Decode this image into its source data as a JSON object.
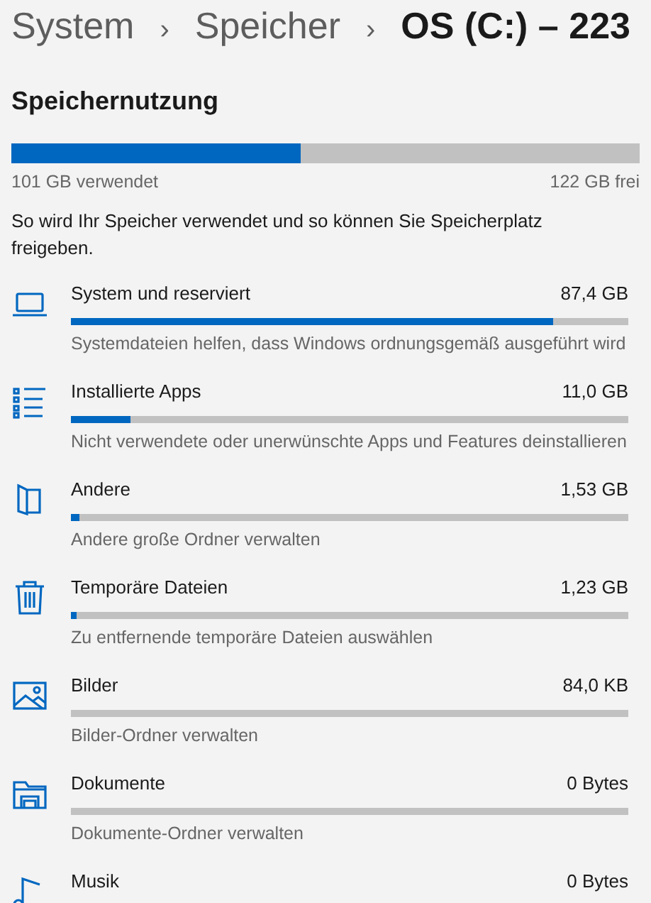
{
  "breadcrumb": [
    "System",
    "Speicher",
    "OS (C:) – 223"
  ],
  "separator": "›",
  "section_title": "Speichernutzung",
  "usage": {
    "level": 0.46,
    "used": "101 GB verwendet",
    "free": "122 GB frei"
  },
  "description": "So wird Ihr Speicher verwendet und so können Sie Speicherplatz freigeben.",
  "categories": [
    {
      "kind": "laptop",
      "name": "System und reserviert",
      "size": "87,4 GB",
      "level": 0.865,
      "hint": "Systemdateien helfen, dass Windows ordnungsgemäß ausgeführt wird"
    },
    {
      "kind": "list",
      "name": "Installierte Apps",
      "size": "11,0 GB",
      "level": 0.108,
      "hint": "Nicht verwendete oder unerwünschte Apps und Features deinstallieren"
    },
    {
      "kind": "folder-open",
      "name": "Andere",
      "size": "1,53 GB",
      "level": 0.015,
      "hint": "Andere große Ordner verwalten"
    },
    {
      "kind": "trash",
      "name": "Temporäre Dateien",
      "size": "1,23 GB",
      "level": 0.01,
      "hint": "Zu entfernende temporäre Dateien auswählen"
    },
    {
      "kind": "image",
      "name": "Bilder",
      "size": "84,0 KB",
      "hint": "Bilder-Ordner verwalten"
    },
    {
      "kind": "folder",
      "name": "Dokumente",
      "size": "0 Bytes",
      "hint": "Dokumente-Ordner verwalten"
    },
    {
      "kind": "music",
      "name": "Musik",
      "size": "0 Bytes"
    }
  ]
}
